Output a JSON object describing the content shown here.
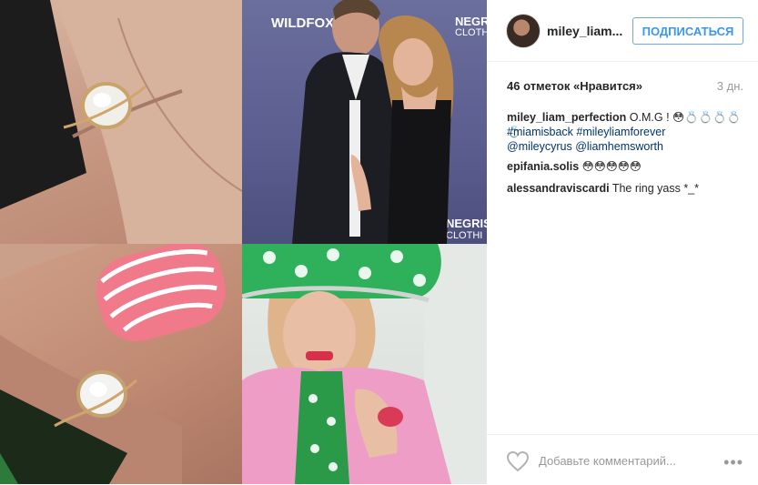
{
  "post": {
    "username": "miley_liam...",
    "follow_label": "ПОДПИСАТЬСЯ",
    "likes": "46 отметок «Нравится»",
    "time": "3 дн.",
    "comments": [
      {
        "user": "miley_liam_perfection",
        "text": " O.M.G ! 😳💍💍💍💍💍"
      },
      {
        "line": "#miamisback #mileyliamforever"
      },
      {
        "line": "@mileycyrus @liamhemsworth"
      },
      {
        "user": "epifania.solis",
        "text": " 😳😳😳😳😳"
      },
      {
        "user": "alessandraviscardi",
        "text": " The ring yass *_*"
      }
    ],
    "add_comment_placeholder": "Добавьте комментарий...",
    "more": "•••"
  },
  "photo_text": {
    "wildfox": "WILDFOX",
    "negris1": "NEGRIS",
    "clothing1": "CLOTHI",
    "negris2": "NEGRIS",
    "clothing2": "CLOTHI"
  },
  "colors": {
    "follow_blue": "#3897f0",
    "link_blue": "#003569"
  }
}
